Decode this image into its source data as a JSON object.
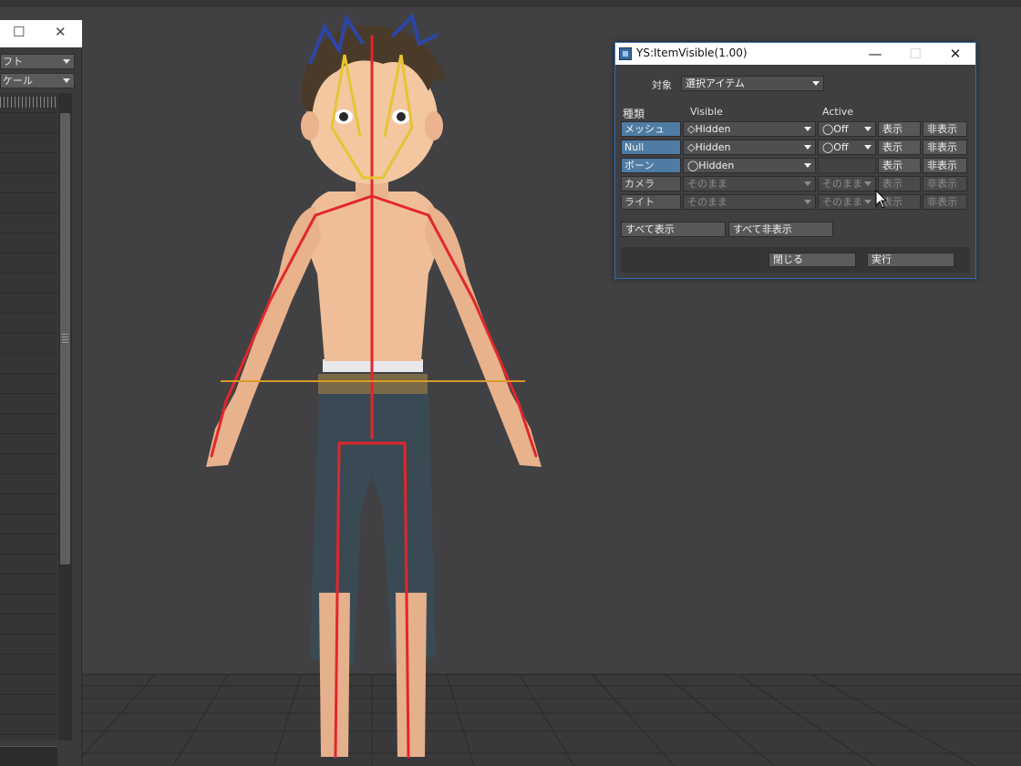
{
  "left_panel": {
    "restore_glyph": "☐",
    "close_glyph": "✕",
    "combo1": "フト",
    "combo2": "ケール"
  },
  "dialog": {
    "title": "YS:ItemVisible(1.00)",
    "window_buttons": {
      "minimize": "—",
      "maximize": "☐",
      "close": "✕"
    },
    "target_label": "対象",
    "target_value": "選択アイテム",
    "col_type": "種類",
    "col_visible": "Visible",
    "col_active": "Active",
    "rows": [
      {
        "type": "メッシュ",
        "visible": "◇Hidden",
        "active": "◯Off",
        "show": "表示",
        "hide": "非表示"
      },
      {
        "type": "Null",
        "visible": "◇Hidden",
        "active": "◯Off",
        "show": "表示",
        "hide": "非表示"
      },
      {
        "type": "ボーン",
        "visible": "◯Hidden",
        "active": "",
        "show": "表示",
        "hide": "非表示"
      },
      {
        "type": "カメラ",
        "visible": "そのまま",
        "active": "そのまま",
        "show": "表示",
        "hide": "非表示"
      },
      {
        "type": "ライト",
        "visible": "そのまま",
        "active": "そのまま",
        "show": "表示",
        "hide": "非表示"
      }
    ],
    "show_all": "すべて表示",
    "hide_all": "すべて非表示",
    "close_button": "閉じる",
    "execute_button": "実行"
  },
  "colors": {
    "viewport": "#414143",
    "bone": "#e3262c",
    "bone_head": "#e6c434",
    "ground_axis": "#d89a28",
    "dialog_border": "#2f6fb3",
    "type_on": "#4f7ca3"
  }
}
